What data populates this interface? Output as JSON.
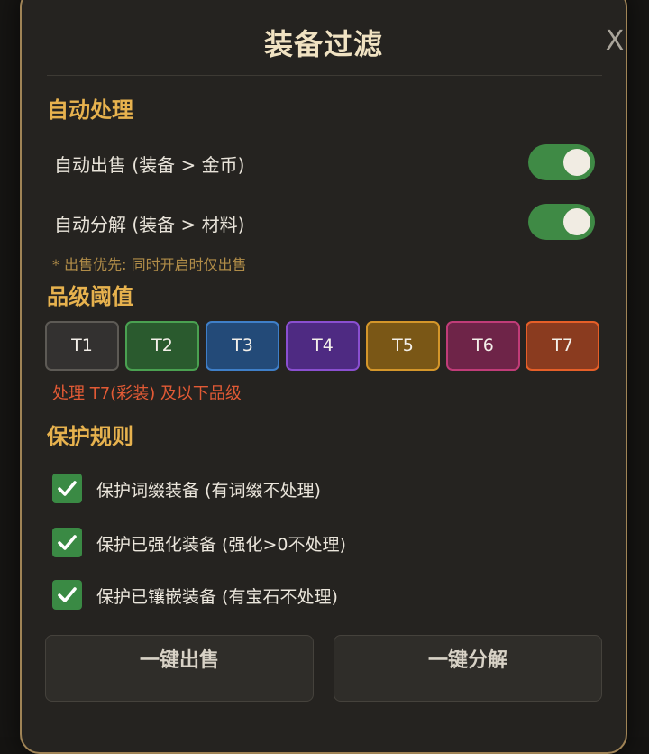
{
  "dialog": {
    "title": "装备过滤",
    "close_label": "X"
  },
  "auto_process": {
    "section_title": "自动处理",
    "items": [
      {
        "label": "自动出售 (装备 > 金币)",
        "enabled": true
      },
      {
        "label": "自动分解 (装备 > 材料)",
        "enabled": true
      }
    ],
    "note": "* 出售优先: 同时开启时仅出售"
  },
  "quality_threshold": {
    "section_title": "品级阈值",
    "tiers": [
      {
        "label": "T1",
        "bg": "#333130",
        "border": "#5d5a55"
      },
      {
        "label": "T2",
        "bg": "#2a5a2e",
        "border": "#4aa151"
      },
      {
        "label": "T3",
        "bg": "#234a78",
        "border": "#3f7fc8"
      },
      {
        "label": "T4",
        "bg": "#4e2a82",
        "border": "#8a4fd0"
      },
      {
        "label": "T5",
        "bg": "#7a5716",
        "border": "#d4962a"
      },
      {
        "label": "T6",
        "bg": "#6e2448",
        "border": "#c03c78"
      },
      {
        "label": "T7",
        "bg": "#8a3b1f",
        "border": "#e65f28"
      }
    ],
    "selected": "T7",
    "description": "处理 T7(彩装) 及以下品级"
  },
  "protection": {
    "section_title": "保护规则",
    "rules": [
      {
        "label": "保护词缀装备 (有词缀不处理)",
        "checked": true
      },
      {
        "label": "保护已强化装备 (强化>0不处理)",
        "checked": true
      },
      {
        "label": "保护已镶嵌装备 (有宝石不处理)",
        "checked": true
      }
    ]
  },
  "actions": {
    "sell_all": "一键出售",
    "dismantle_all": "一键分解"
  },
  "colors": {
    "accent": "#e7b24e",
    "toggle_on": "#3f8a45",
    "checkbox": "#3a8a44",
    "panel_border": "#a08456",
    "threshold_text": "#e25a35"
  }
}
